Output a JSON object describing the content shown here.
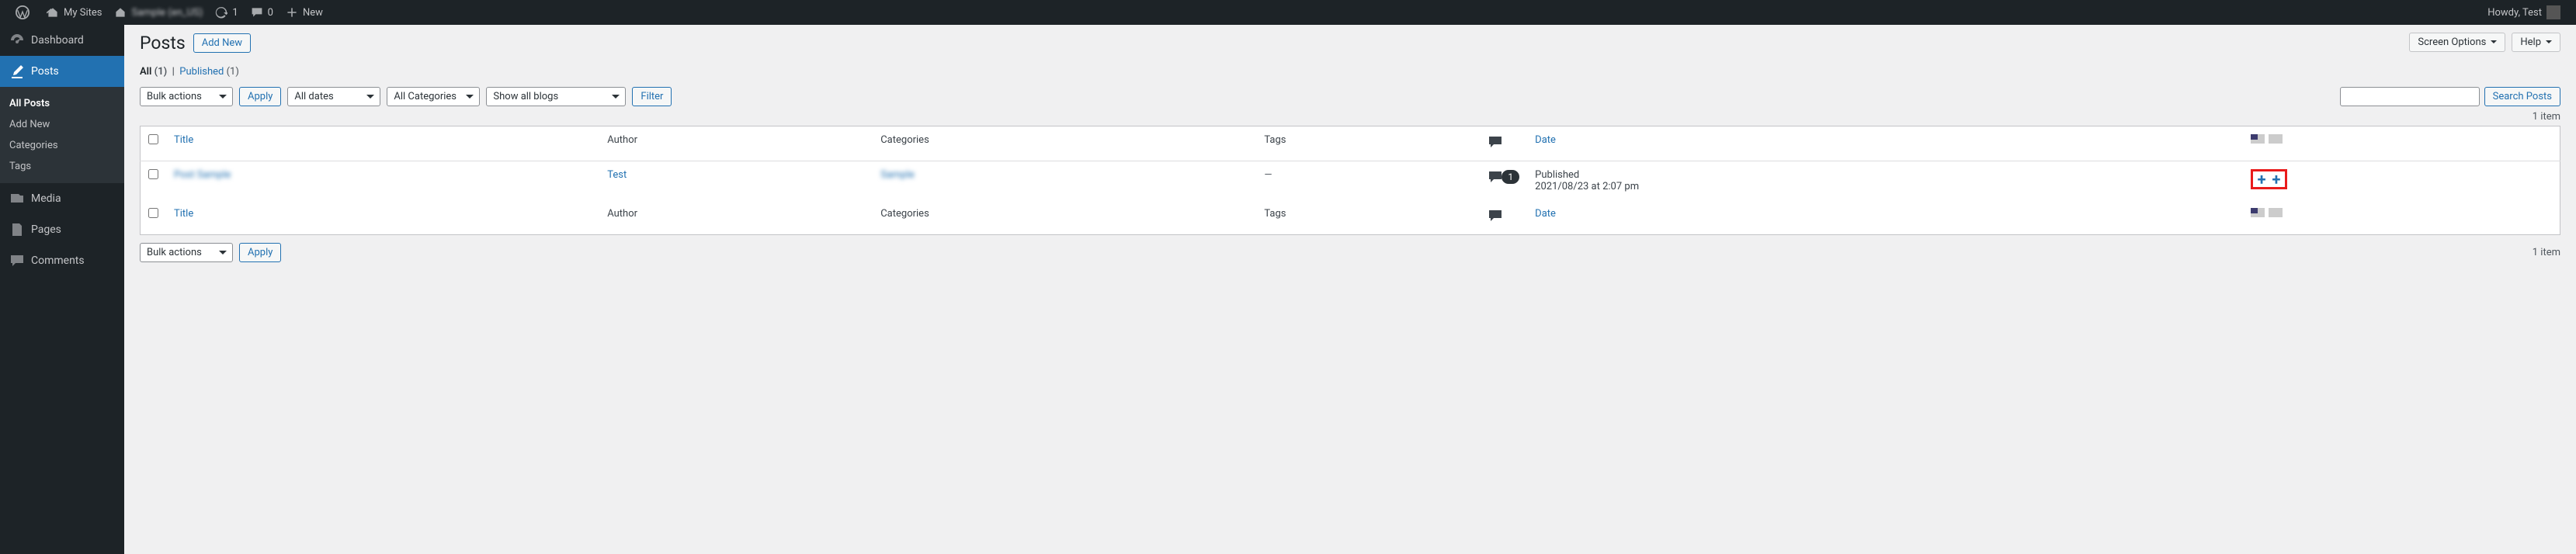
{
  "admin_bar": {
    "my_sites": "My Sites",
    "site_name": "Sample (en_US)",
    "updates_count": "1",
    "comments_count": "0",
    "new_label": "New",
    "howdy": "Howdy, Test"
  },
  "sidebar": {
    "dashboard": "Dashboard",
    "posts": "Posts",
    "media": "Media",
    "pages": "Pages",
    "comments": "Comments",
    "sub": {
      "all_posts": "All Posts",
      "add_new": "Add New",
      "categories": "Categories",
      "tags": "Tags"
    }
  },
  "page": {
    "title": "Posts",
    "add_new": "Add New",
    "screen_options": "Screen Options",
    "help": "Help"
  },
  "status_links": {
    "all": "All",
    "all_count": "(1)",
    "sep": "|",
    "published": "Published",
    "published_count": "(1)"
  },
  "filters": {
    "bulk": "Bulk actions",
    "apply": "Apply",
    "dates": "All dates",
    "categories": "All Categories",
    "blogs": "Show all blogs",
    "filter": "Filter",
    "search": "Search Posts"
  },
  "nav": {
    "items": "1 item"
  },
  "columns": {
    "title": "Title",
    "author": "Author",
    "categories": "Categories",
    "tags": "Tags",
    "date": "Date"
  },
  "row": {
    "title": "Post Sample",
    "author": "Test",
    "category": "Sample",
    "tags": "—",
    "comments": "1",
    "date_status": "Published",
    "date_value": "2021/08/23 at 2:07 pm",
    "plus1": "+",
    "plus2": "+"
  }
}
